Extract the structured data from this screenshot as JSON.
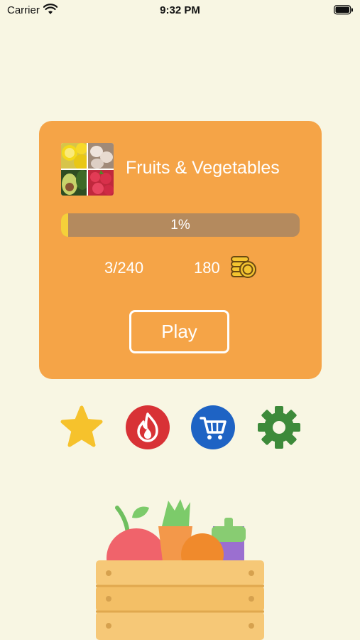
{
  "status_bar": {
    "carrier": "Carrier",
    "time": "9:32 PM"
  },
  "category": {
    "title": "Fruits & Vegetables",
    "thumbnail_icons": [
      "lemon-photo-icon",
      "garlic-photo-icon",
      "avocado-photo-icon",
      "raspberry-photo-icon"
    ],
    "progress_percent": 1,
    "progress_label": "1%",
    "levels": "3/240",
    "coins": "180",
    "play_label": "Play"
  },
  "menu": [
    {
      "name": "favorites-button",
      "icon": "star-icon",
      "color": "#f6c22c"
    },
    {
      "name": "hot-button",
      "icon": "flame-icon",
      "color": "#d83236"
    },
    {
      "name": "shop-button",
      "icon": "cart-icon",
      "color": "#1e63c4"
    },
    {
      "name": "settings-button",
      "icon": "gear-icon",
      "color": "#3d8a3a"
    }
  ],
  "decoration": {
    "illustration": "vegetable-crate-icon"
  },
  "colors": {
    "background": "#f8f6e3",
    "card": "#f5a447",
    "progress_track": "#b48a5e",
    "progress_fill": "#f5d03a"
  }
}
